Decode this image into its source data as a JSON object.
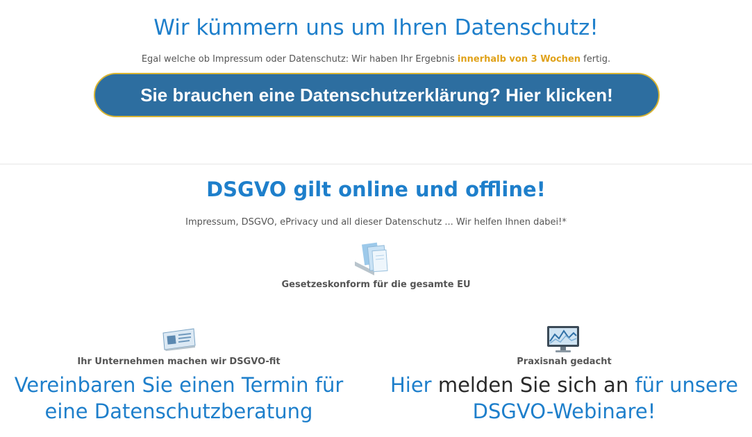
{
  "hero": {
    "title": "Wir kümmern uns um Ihren Datenschutz!",
    "subtitle_prefix": "Egal welche ob Impressum oder Datenschutz: Wir haben Ihr Ergebnis ",
    "subtitle_highlight": "innerhalb von 3 Wochen",
    "subtitle_suffix": " fertig.",
    "cta_label": "Sie brauchen eine Datenschutzerklärung? Hier klicken!"
  },
  "section": {
    "title": "DSGVO gilt online und offline!",
    "subtitle": "Impressum, DSGVO, ePrivacy und all dieser Datenschutz ... Wir helfen Ihnen dabei!*",
    "feature_icon": "documents-icon",
    "feature_label": "Gesetzeskonform für die gesamte EU"
  },
  "columns": {
    "left": {
      "icon": "id-card-icon",
      "label": "Ihr Unternehmen machen wir DSGVO-fit",
      "link_line1": "Vereinbaren Sie einen Termin für",
      "link_line2": "eine Datenschutzberatung"
    },
    "right": {
      "icon": "monitor-chart-icon",
      "label": "Praxisnah gedacht",
      "link_part1": "Hier",
      "link_part2": " melden Sie sich an ",
      "link_part3": "für unsere",
      "link_line2": "DSGVO-Webinare!"
    }
  },
  "colors": {
    "accent_blue": "#1e7fcb",
    "button_blue": "#2d6ea0",
    "button_border": "#d8b432",
    "highlight": "#e0a21a"
  }
}
